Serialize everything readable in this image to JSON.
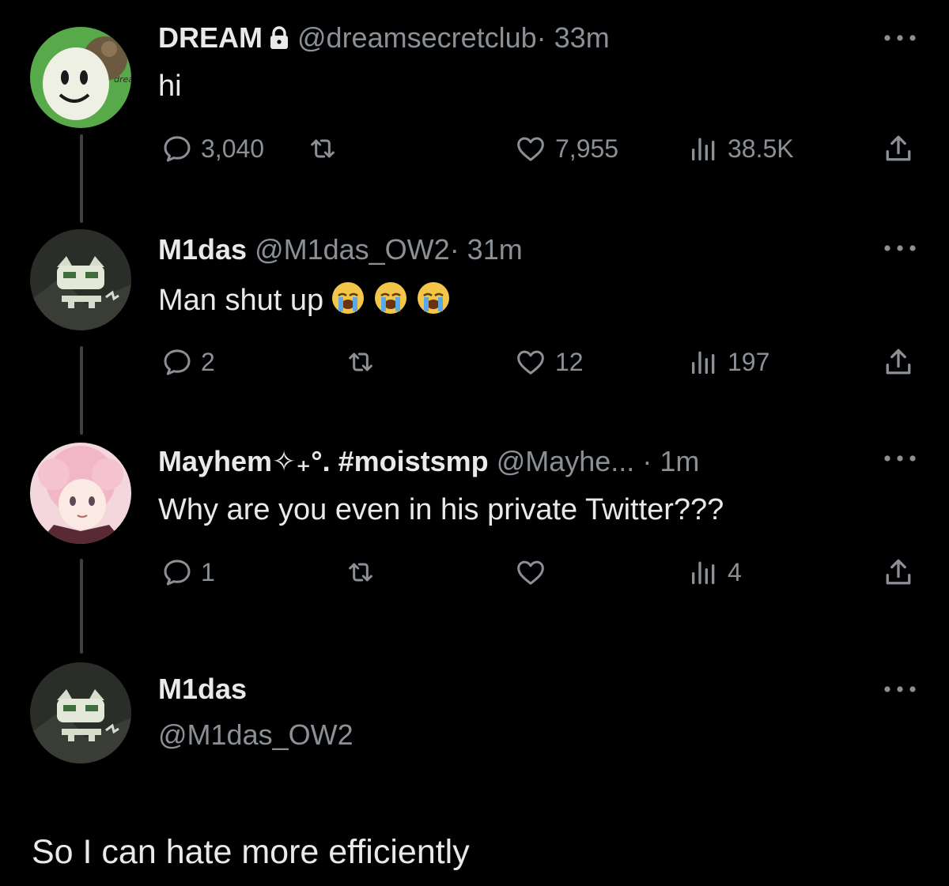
{
  "tweets": [
    {
      "name": "DREAM",
      "handle": "@dreamsecretclub",
      "time": "· 33m",
      "text": "hi",
      "avatar_label": "dream",
      "locked": true,
      "replies": "3,040",
      "retweets": "",
      "likes": "7,955",
      "views": "38.5K"
    },
    {
      "name": "M1das",
      "handle": "@M1das_OW2",
      "time": "· 31m",
      "text": "Man shut up",
      "emojis": [
        "loudly-crying-face",
        "loudly-crying-face",
        "loudly-crying-face"
      ],
      "replies": "2",
      "retweets": "",
      "likes": "12",
      "views": "197"
    },
    {
      "name": "Mayhem✧₊°. #moistsmp",
      "handle": "@Mayhe...",
      "time": "· 1m",
      "text": "Why are you even in his private Twitter???",
      "replies": "1",
      "retweets": "",
      "likes": "",
      "views": "4"
    }
  ],
  "focused_tweet": {
    "name": "M1das",
    "handle": "@M1das_OW2",
    "text": "So I can hate more efficiently"
  },
  "icons": {
    "reply": "reply-icon",
    "retweet": "retweet-icon",
    "like": "heart-icon",
    "views": "views-icon",
    "share": "share-icon",
    "more": "more-icon",
    "lock": "lock-icon"
  },
  "colors": {
    "background": "#000000",
    "text_primary": "#e7e9ea",
    "text_secondary": "#8b9096",
    "thread_line": "#3e4144"
  }
}
